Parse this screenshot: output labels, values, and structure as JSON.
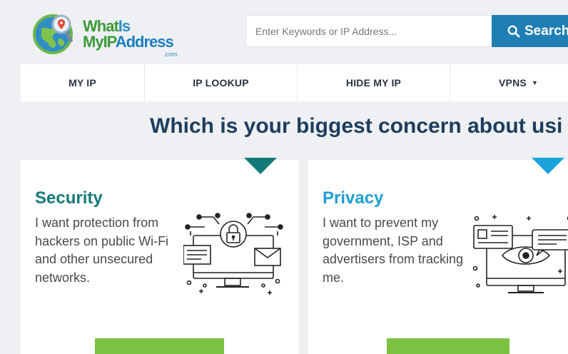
{
  "logo": {
    "line1_a": "What",
    "line1_b": "Is",
    "line2_a": "My",
    "line2_b": "IP",
    "line2_c": "Address",
    "com": ".com"
  },
  "search": {
    "placeholder": "Enter Keywords or IP Address...",
    "value": "",
    "button_label": "Search"
  },
  "nav": {
    "items": [
      {
        "label": "MY IP"
      },
      {
        "label": "IP LOOKUP"
      },
      {
        "label": "HIDE MY IP"
      },
      {
        "label": "VPNS"
      }
    ]
  },
  "heading": "Which is your biggest concern about usi",
  "cards": [
    {
      "title": "Security",
      "description": "I want protection from hackers on public Wi-Fi and other unsecured networks."
    },
    {
      "title": "Privacy",
      "description": "I want to prevent my government, ISP and advertisers from tracking me."
    }
  ],
  "colors": {
    "search_button": "#1f7fb5",
    "security_accent": "#147a78",
    "privacy_accent": "#1e9fd4",
    "cta_green": "#7cc142",
    "heading": "#1e3d5e"
  },
  "icons": [
    "globe-logo-icon",
    "search-icon",
    "caret-down-icon",
    "security-illustration-icon",
    "privacy-illustration-icon"
  ]
}
